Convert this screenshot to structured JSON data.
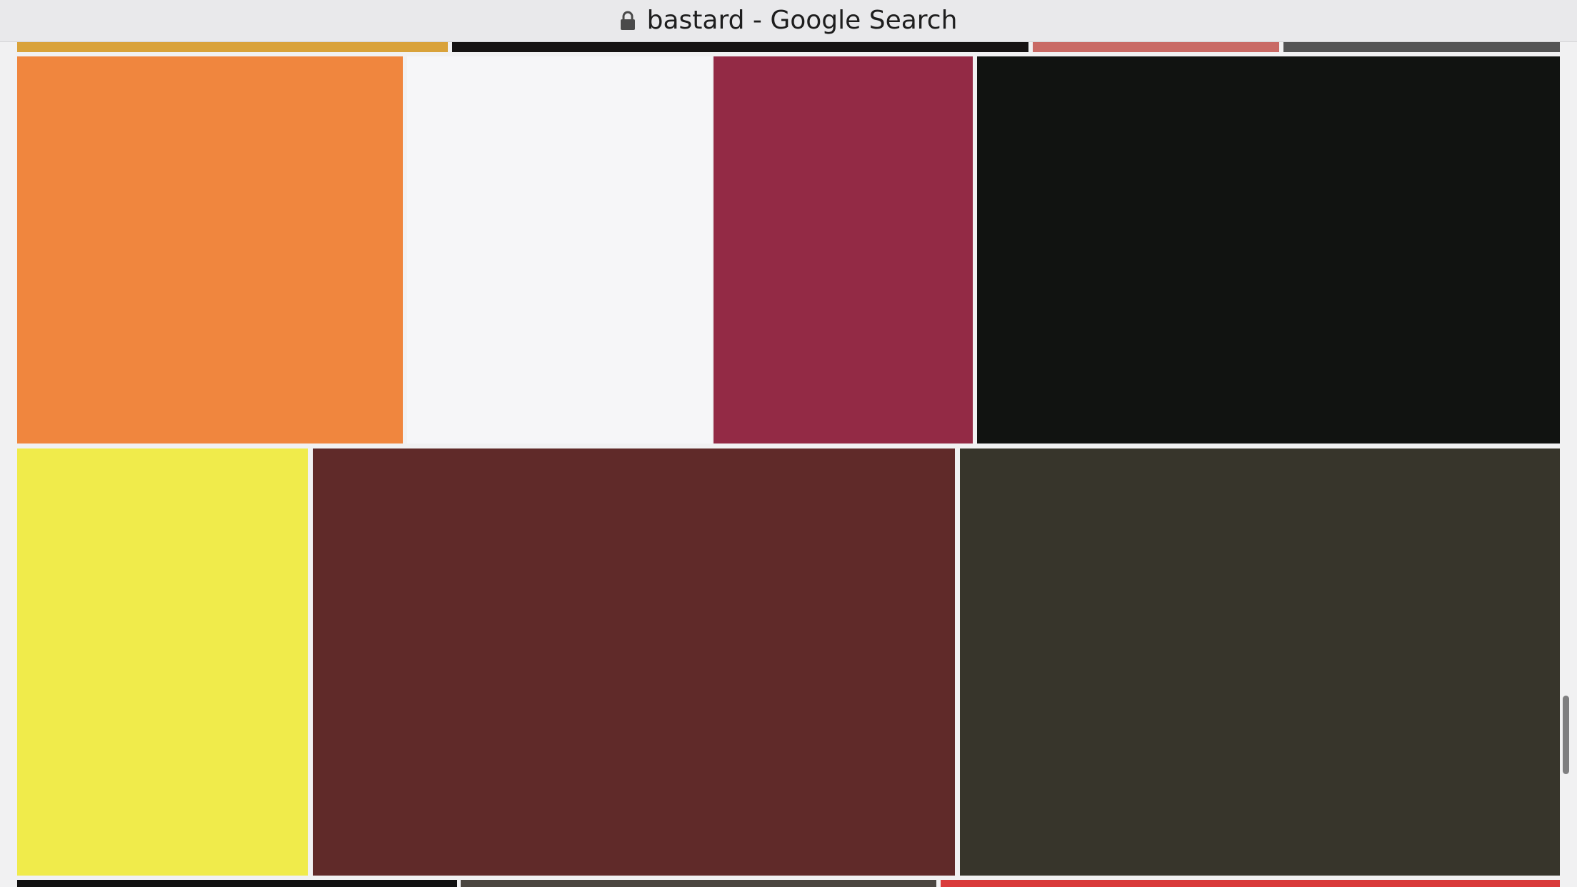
{
  "window": {
    "title": "bastard - Google Search",
    "lock_icon": "lock-icon"
  },
  "image_rows": [
    {
      "row": "partial-top",
      "tiles": [
        {
          "color": "#d9a23a"
        },
        {
          "color": "#161313"
        },
        {
          "color": "#c96a65"
        },
        {
          "color": "#545454"
        }
      ]
    },
    {
      "row": "row-1",
      "tiles": [
        {
          "color": "#f0863e"
        },
        {
          "color": "#f6f6f8"
        },
        {
          "color": "#932a45"
        },
        {
          "color": "#111311"
        }
      ]
    },
    {
      "row": "row-2",
      "tiles": [
        {
          "color": "#f0eb4b"
        },
        {
          "color": "#602a29"
        },
        {
          "color": "#37352b"
        }
      ]
    },
    {
      "row": "partial-bottom",
      "tiles": [
        {
          "color": "#111111"
        },
        {
          "color": "#4b4640"
        },
        {
          "color": "#d93a3a"
        }
      ]
    }
  ]
}
